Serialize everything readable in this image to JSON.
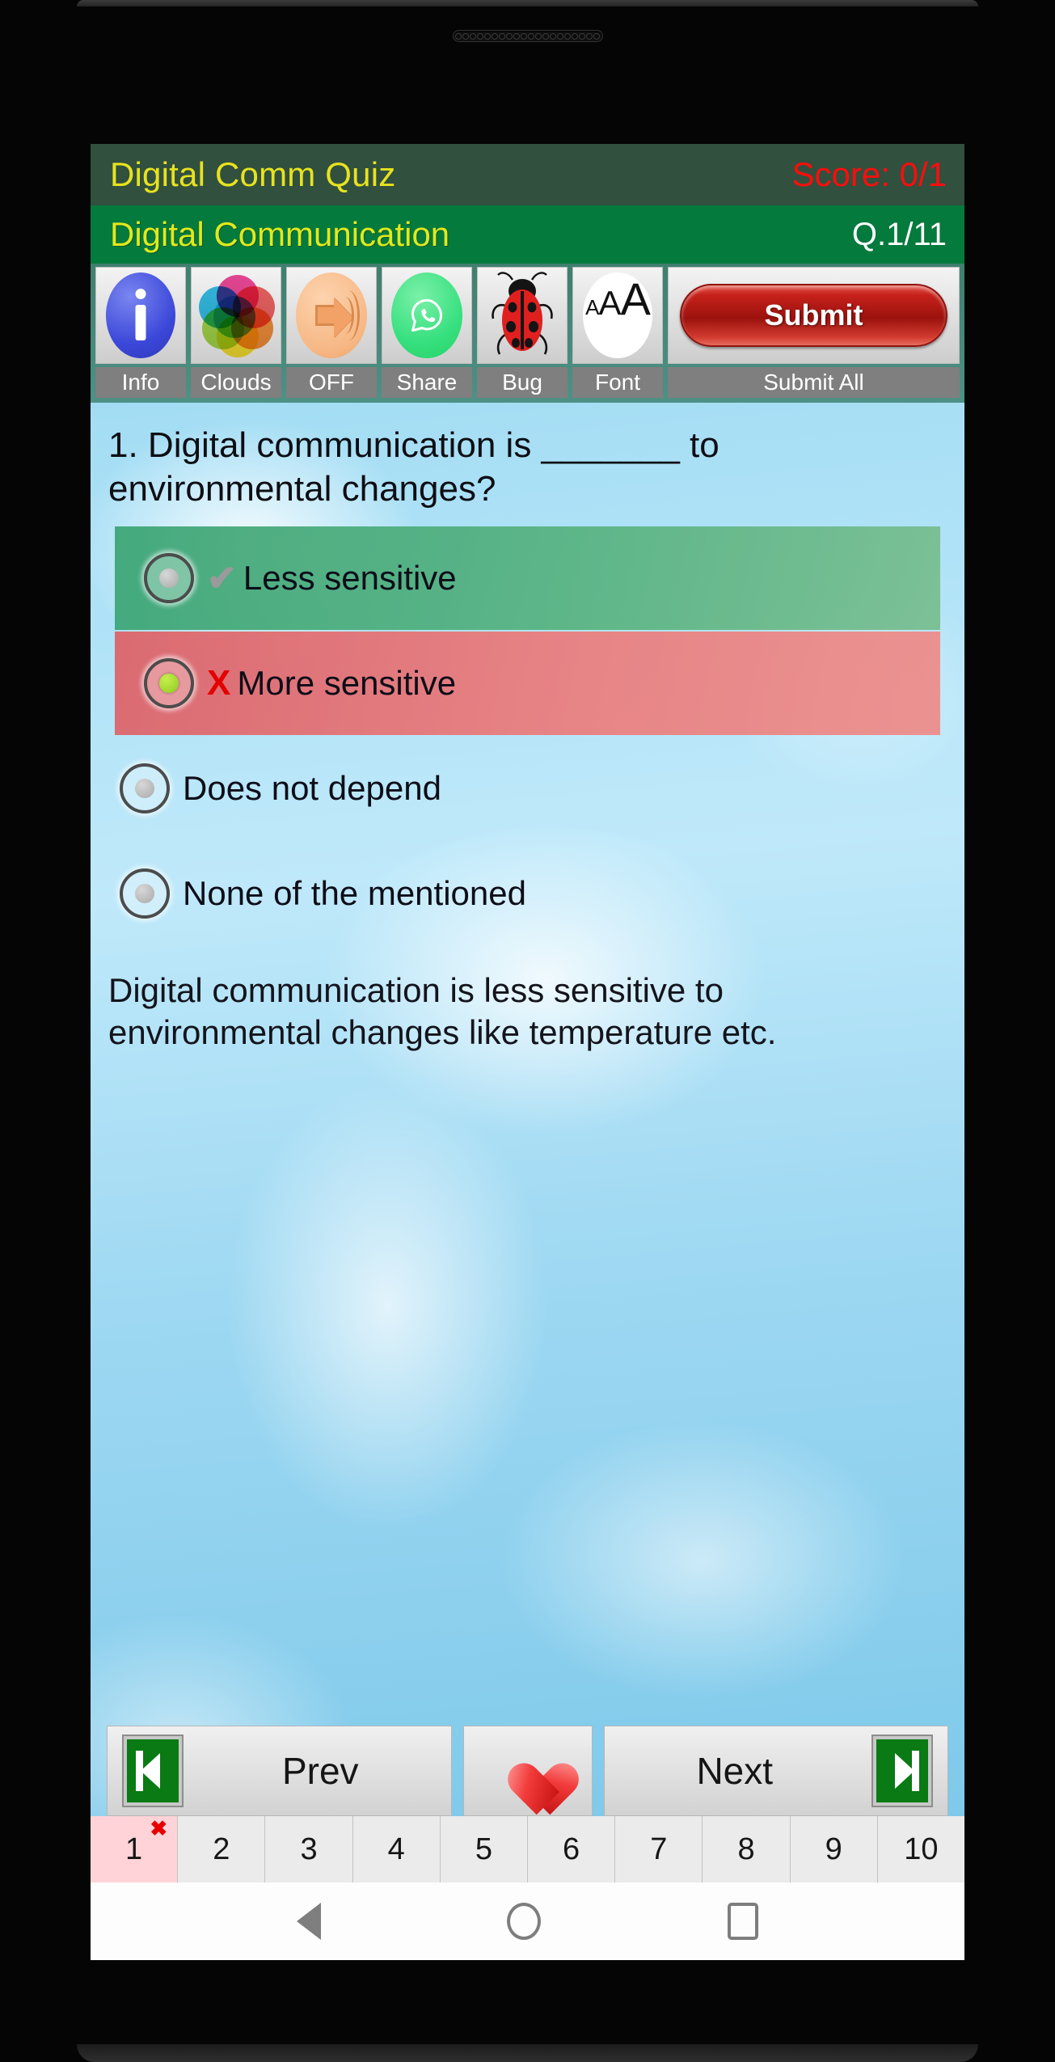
{
  "app": {
    "title": "Digital Comm Quiz",
    "score_label": "Score: 0/1",
    "subject": "Digital Communication",
    "question_counter": "Q.1/11"
  },
  "colors": {
    "titlebar_bg": "#31503e",
    "title_text": "#e8e21f",
    "score_text": "#fb0d0d",
    "subject_bg": "#047a3c",
    "subject_text": "#e2e81c",
    "correct_row": "#3aa474",
    "wrong_row": "#dd6066",
    "submit_button": "#c6211a",
    "background": "#9ed8f2"
  },
  "toolbar": {
    "items": [
      {
        "label": "Info",
        "icon": "info-icon"
      },
      {
        "label": "Clouds",
        "icon": "color-wheel-icon"
      },
      {
        "label": "OFF",
        "icon": "speaker-icon"
      },
      {
        "label": "Share",
        "icon": "whatsapp-icon"
      },
      {
        "label": "Bug",
        "icon": "ladybug-icon"
      },
      {
        "label": "Font",
        "icon": "font-size-icon"
      }
    ],
    "submit_button_label": "Submit",
    "submit_all_label": "Submit All"
  },
  "question": {
    "text": "1. Digital communication is _______ to environmental changes?",
    "options": [
      {
        "text": "Less sensitive",
        "state": "correct",
        "mark": "✔",
        "selected": false
      },
      {
        "text": "More sensitive",
        "state": "wrong",
        "mark": "X",
        "selected": true
      },
      {
        "text": "Does not depend",
        "state": "neutral",
        "mark": "",
        "selected": false
      },
      {
        "text": "None of the mentioned",
        "state": "neutral",
        "mark": "",
        "selected": false
      }
    ],
    "explanation": "Digital communication is less sensitive to environmental changes like temperature etc."
  },
  "nav": {
    "prev_label": "Prev",
    "next_label": "Next",
    "favorite_icon": "heart-icon"
  },
  "pager": {
    "pages": [
      "1",
      "2",
      "3",
      "4",
      "5",
      "6",
      "7",
      "8",
      "9",
      "10"
    ],
    "current": "1",
    "current_mark": "✖"
  },
  "system_nav": {
    "back": "back-triangle-icon",
    "home": "home-circle-icon",
    "recents": "recents-square-icon"
  }
}
